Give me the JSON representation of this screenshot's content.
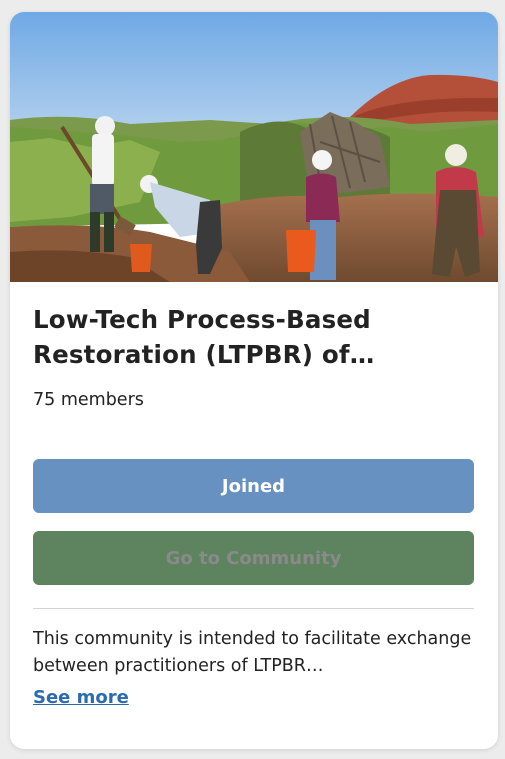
{
  "card": {
    "title": "Low-Tech Process-Based Restoration (LTPBR) of…",
    "members": "75 members",
    "joined_button": "Joined",
    "community_button": "Go to Community",
    "description": "This community is intended to facilitate exchange between practitioners of LTPBR…",
    "see_more": "See more"
  },
  "colors": {
    "joined_button_bg": "#6691c1",
    "community_button_bg": "#5e835f",
    "link": "#2a6cae"
  }
}
